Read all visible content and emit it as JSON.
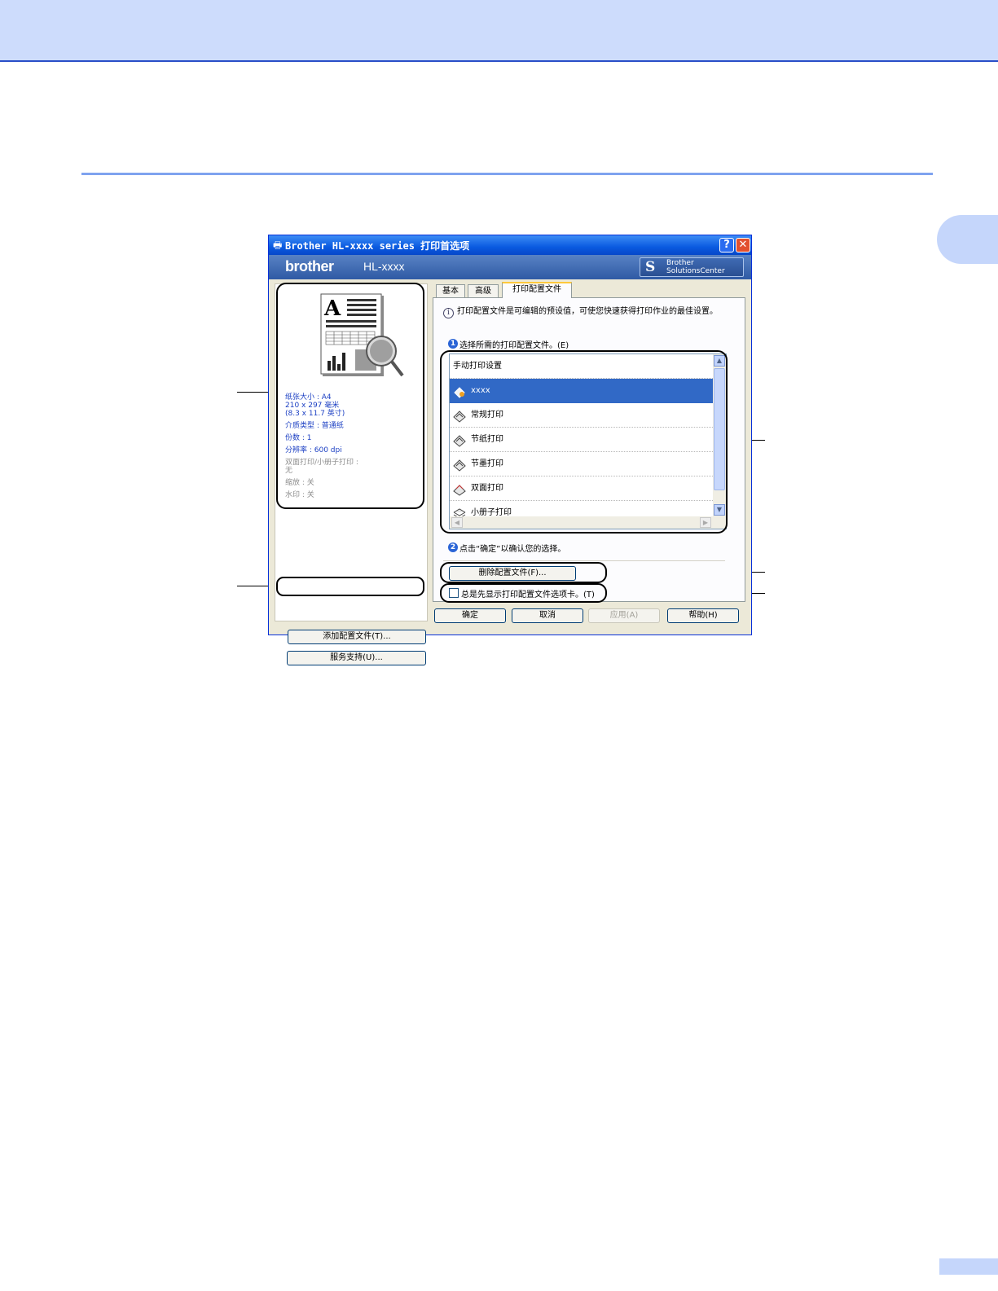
{
  "dialog": {
    "title": "Brother HL-xxxx series 打印首选项",
    "help_glyph": "?",
    "close_glyph": "✕",
    "brand_logo": "brother",
    "model": "HL-xxxx",
    "solutions_line1": "Brother",
    "solutions_line2": "SolutionsCenter"
  },
  "left_pane": {
    "settings": [
      {
        "text": "纸张大小 : A4",
        "style": "blue"
      },
      {
        "text": "210 x 297 毫米",
        "style": "blue"
      },
      {
        "text": "(8.3 x 11.7 英寸)",
        "style": "blue"
      },
      {
        "text": "介质类型 : 普通纸",
        "style": "blue"
      },
      {
        "text": "份数 : 1",
        "style": "blue"
      },
      {
        "text": "分辨率 : 600 dpi",
        "style": "blue"
      },
      {
        "text": "双面打印/小册子打印 :",
        "style": "gray"
      },
      {
        "text": "无",
        "style": "gray"
      },
      {
        "text": "缩放 : 关",
        "style": "gray"
      },
      {
        "text": "水印 : 关",
        "style": "gray"
      }
    ],
    "add_profile_button": "添加配置文件(T)...",
    "support_button": "服务支持(U)..."
  },
  "tabs": [
    "基本",
    "高级",
    "打印配置文件"
  ],
  "profiles_tab": {
    "info_text": "打印配置文件是可编辑的预设值，可使您快速获得打印作业的最佳设置。",
    "step1_number": "1",
    "step1_label": "选择所需的打印配置文件。(E)",
    "list_items": [
      {
        "label": "手动打印设置",
        "icon": "none"
      },
      {
        "label": "xxxx",
        "icon": "user-profile-icon"
      },
      {
        "label": "常规打印",
        "icon": "print-profile-icon"
      },
      {
        "label": "节纸打印",
        "icon": "print-profile-icon"
      },
      {
        "label": "节墨打印",
        "icon": "print-profile-icon"
      },
      {
        "label": "双面打印",
        "icon": "duplex-profile-icon"
      },
      {
        "label": "小册子打印",
        "icon": "booklet-profile-icon"
      }
    ],
    "selected_index": 1,
    "step2_number": "2",
    "step2_label": "点击“确定”以确认您的选择。",
    "delete_button": "删除配置文件(F)...",
    "always_show_label": "总是先显示打印配置文件选项卡。(T)",
    "always_show_checked": false
  },
  "buttons": {
    "ok": "确定",
    "cancel": "取消",
    "apply": "应用(A)",
    "help": "帮助(H)"
  },
  "colors": {
    "header_band": "#cddcfc",
    "titlebar": "#0a5ae0",
    "selection": "#3169c6",
    "settings_text": "#1b3fc3"
  }
}
